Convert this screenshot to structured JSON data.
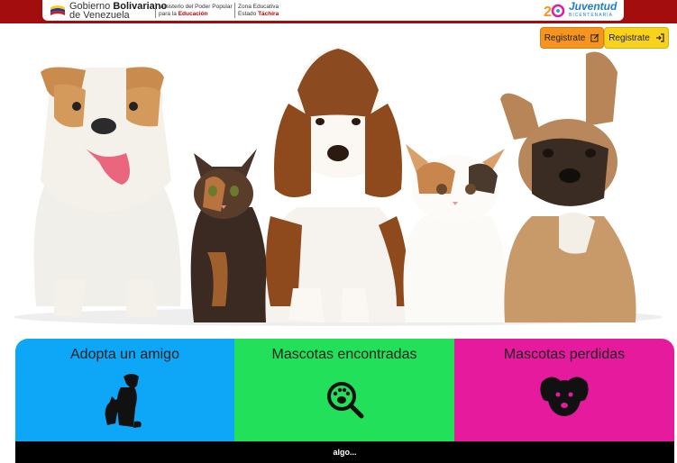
{
  "header": {
    "gov_name_prefix": "Gobierno",
    "gov_name_bold": "Bolivariano",
    "gov_name_line2": "de Venezuela",
    "ministry_line1": "Ministerio del Poder Popular",
    "ministry_line2_prefix": "para la",
    "ministry_line2_bold": "Educación",
    "zone_line1": "Zona Educativa",
    "zone_line2_prefix": "Estado",
    "zone_line2_bold": "Táchira",
    "juventud": "Juventud",
    "bicentenaria": "BICENTENARIA",
    "colors": {
      "bar": "#a30d0d",
      "accent_red": "#b30000"
    }
  },
  "actions": {
    "register_orange": {
      "label": "Registrate",
      "icon": "edit-icon",
      "color": "#f7941d"
    },
    "register_yellow": {
      "label": "Registrate",
      "icon": "sign-in-icon",
      "color": "#f8d21b"
    }
  },
  "hero": {
    "icon": "pets-photo",
    "subjects": [
      "bulldog",
      "kitten",
      "basset-hound",
      "exotic-cat",
      "french-bulldog"
    ]
  },
  "categories": [
    {
      "title": "Adopta un amigo",
      "icon": "dog-cat-icon",
      "color": "#0ea6f7"
    },
    {
      "title": "Mascotas encontradas",
      "icon": "paw-search-icon",
      "color": "#22e05a"
    },
    {
      "title": "Mascotas perdidas",
      "icon": "dog-face-icon",
      "color": "#e61a9d"
    }
  ],
  "footer": {
    "text": "algo..."
  }
}
